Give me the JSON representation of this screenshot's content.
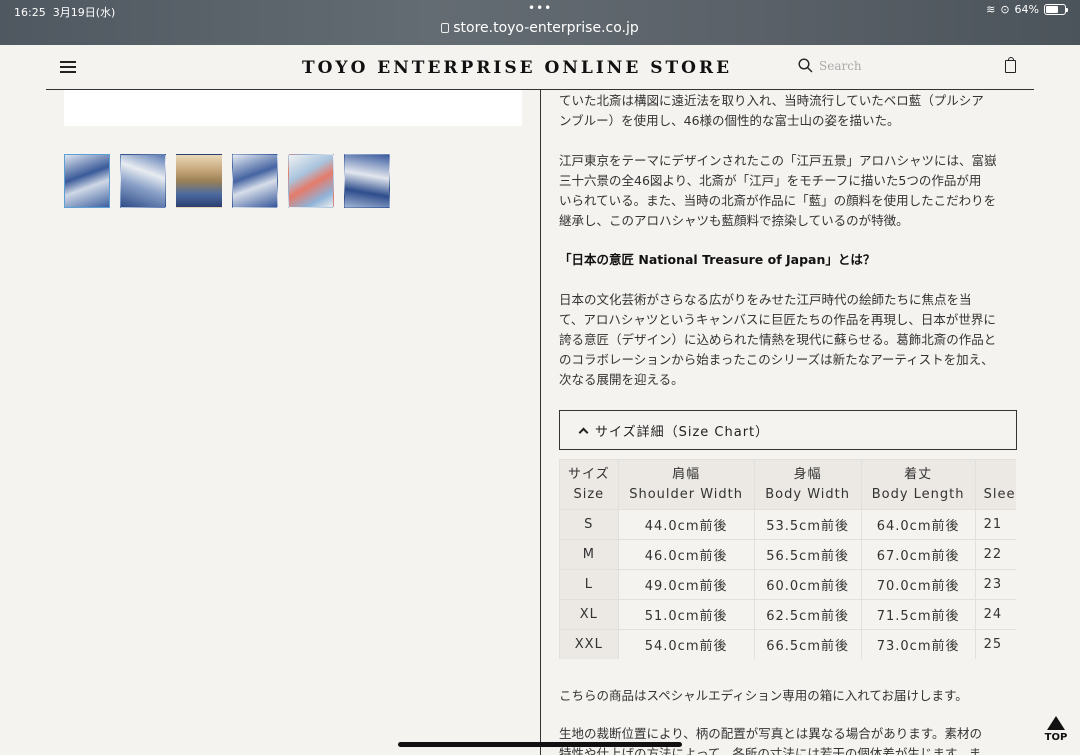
{
  "status_bar": {
    "time": "16:25",
    "date": "3月19日(水)",
    "battery": "64%"
  },
  "browser": {
    "url": "store.toyo-enterprise.co.jp"
  },
  "header": {
    "brand": "TOYO ENTERPRISE ONLINE STORE",
    "search_placeholder": "Search"
  },
  "thumbnails": [
    "thumb-1",
    "thumb-2",
    "thumb-3",
    "thumb-4",
    "thumb-5",
    "thumb-6"
  ],
  "content": {
    "p1": "ていた北斎は構図に遠近法を取り入れ、当時流行していたベロ藍（プルシア\nンブルー）を使用し、46様の個性的な富士山の姿を描いた。",
    "p2": "江戸東京をテーマにデザインされたこの「江戸五景」アロハシャツには、富嶽\n三十六景の全46図より、北斎が「江戸」をモチーフに描いた5つの作品が用\nいられている。また、当時の北斎が作品に「藍」の顔料を使用したこだわりを\n継承し、このアロハシャツも藍顔料で捺染しているのが特徴。",
    "heading": "「日本の意匠 National Treasure of Japan」とは？",
    "p3": "日本の文化芸術がさらなる広がりをみせた江戸時代の絵師たちに焦点を当\nて、アロハシャツというキャンバスに巨匠たちの作品を再現し、日本が世界に\n誇る意匠（デザイン）に込められた情熱を現代に蘇らせる。葛飾北斎の作品と\nのコラボレーションから始まったこのシリーズは新たなアーティストを加え、\n次なる展開を迎える。",
    "size_toggle": "サイズ詳細（Size Chart）",
    "p4": "こちらの商品はスペシャルエディション専用の箱に入れてお届けします。",
    "p5": "生地の裁断位置により、柄の配置が写真とは異なる場合があります。素材の\n特性や仕上げの方法によって、各所の寸法には若干の個体差が生じます。ま"
  },
  "size_table": {
    "headers": [
      [
        "サイズ",
        "Size"
      ],
      [
        "肩幅",
        "Shoulder Width"
      ],
      [
        "身幅",
        "Body Width"
      ],
      [
        "着丈",
        "Body Length"
      ],
      [
        "",
        "Slee"
      ]
    ],
    "rows": [
      [
        "S",
        "44.0cm前後",
        "53.5cm前後",
        "64.0cm前後",
        "21"
      ],
      [
        "M",
        "46.0cm前後",
        "56.5cm前後",
        "67.0cm前後",
        "22"
      ],
      [
        "L",
        "49.0cm前後",
        "60.0cm前後",
        "70.0cm前後",
        "23"
      ],
      [
        "XL",
        "51.0cm前後",
        "62.5cm前後",
        "71.5cm前後",
        "24"
      ],
      [
        "XXL",
        "54.0cm前後",
        "66.5cm前後",
        "73.0cm前後",
        "25"
      ]
    ]
  },
  "top_button": "TOP"
}
